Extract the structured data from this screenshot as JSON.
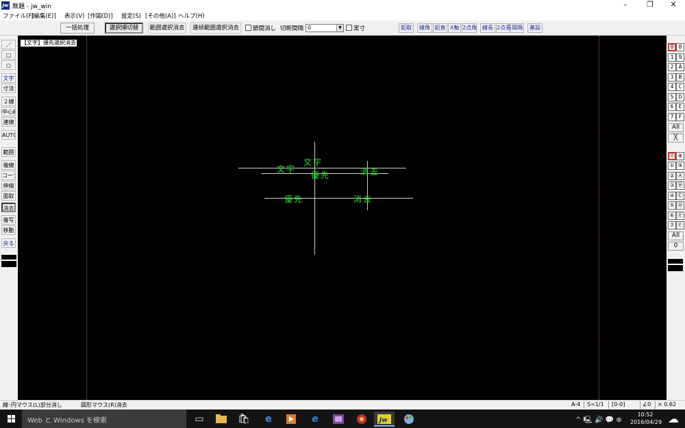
{
  "window": {
    "title": "無題 - jw_win",
    "app_icon": "Jw",
    "controls": [
      "–",
      "❐",
      "✕"
    ]
  },
  "menu": [
    "ファイル(F)",
    "[編集(E)]",
    "表示(V)",
    "[作図(D)]",
    "設定(S)",
    "[その他(A)]",
    "ヘルプ(H)"
  ],
  "toolbar": {
    "bulk_process": "一括処理",
    "select_order": "選択順切替",
    "range_clear": "範囲選択消去",
    "continuous_range_clear": "連続範囲選択消去",
    "node_erase_label": "節間消し",
    "cut_interval_label": "切断間隔",
    "cut_interval_value": "0",
    "actual_size_label": "実寸",
    "right_buttons": [
      "鉛取",
      "線角",
      "鉛直",
      "X軸",
      "2点角",
      "線長",
      "2点長",
      "間隔",
      "基設"
    ]
  },
  "left_tools": [
    "／",
    "□",
    "○",
    "文字",
    "寸法",
    "２線",
    "中心線",
    "連線",
    "AUTO",
    "範囲",
    "複線",
    "コーナー",
    "伸縮",
    "面取",
    "消去",
    "複写",
    "移動",
    "戻る"
  ],
  "canvas": {
    "mode_label": "【文字】優先選択消去",
    "texts": [
      {
        "id": "t1",
        "text": "文字"
      },
      {
        "id": "t2",
        "text": "文字"
      },
      {
        "id": "t3",
        "text": "優先"
      },
      {
        "id": "t4",
        "text": "消去"
      },
      {
        "id": "t5",
        "text": "優先"
      },
      {
        "id": "t6",
        "text": "消去"
      }
    ],
    "text_color": "#22e022",
    "line_color": "#d0d0d0",
    "guide_color": "#c050c0"
  },
  "layer_groups": {
    "layers_top": [
      "0",
      "8",
      "1",
      "9",
      "2",
      "A",
      "3",
      "B",
      "4",
      "C",
      "5",
      "D",
      "6",
      "E",
      "7",
      "F"
    ],
    "all_label": "All",
    "cross_label": "╳",
    "groups_bottom": [
      "⓪",
      "⑧",
      "①",
      "⑨",
      "②",
      "Ⓐ",
      "③",
      "Ⓑ",
      "④",
      "Ⓒ",
      "⑤",
      "Ⓓ",
      "⑥",
      "Ⓔ",
      "⑦",
      "Ⓕ"
    ],
    "all_label_2": "All",
    "zero_label": "0"
  },
  "status": {
    "left_hint": "線･円マウス(L)部分消し",
    "right_hint": "図形マウス(R)消去",
    "paper": "A-4",
    "scale": "S=1/1",
    "layer": "[0-0]",
    "angle": "∠0",
    "zoom": "× 0.62"
  },
  "taskbar": {
    "search_placeholder": "Web と Windows を検索",
    "time": "10:52",
    "date": "2016/04/29",
    "tray_icons": "^ 🖳 🔊 💬 ⊗"
  }
}
